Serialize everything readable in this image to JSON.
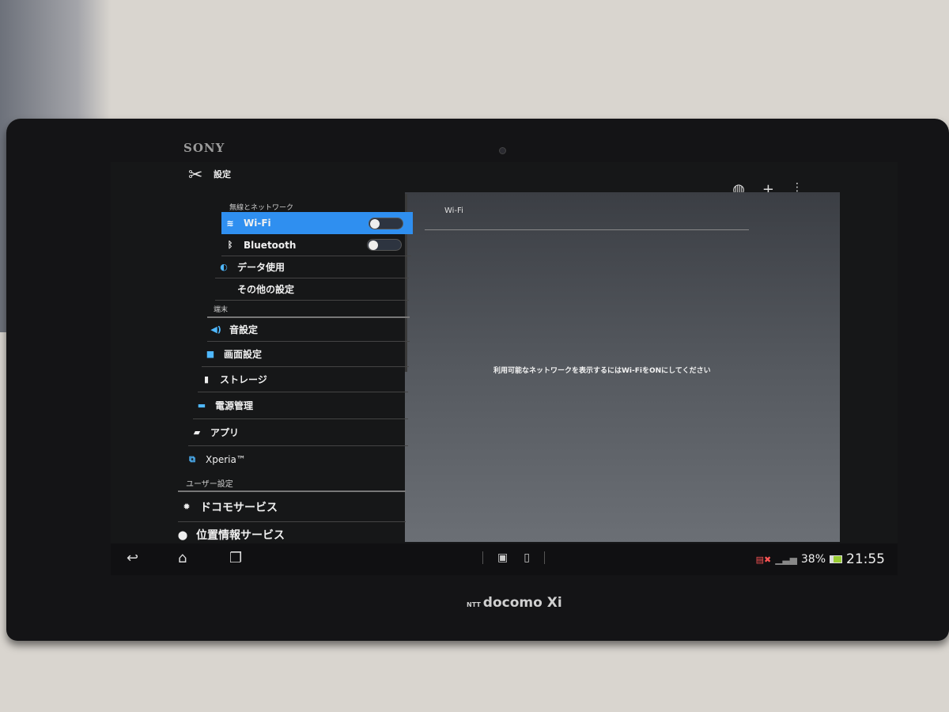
{
  "device": {
    "brand": "SONY",
    "carrier": "docomo Xi",
    "carrier_prefix": "NTT"
  },
  "app": {
    "title": "設定",
    "icon": "tools-icon"
  },
  "actionbar": {
    "icons": [
      "globe-icon",
      "plus-icon",
      "overflow-menu-icon"
    ]
  },
  "sections": {
    "wireless": "無線とネットワーク",
    "device": "端末",
    "user": "ユーザー設定"
  },
  "items": [
    {
      "label": "Wi-Fi",
      "icon": "wifi-icon",
      "toggle": false,
      "selected": true
    },
    {
      "label": "Bluetooth",
      "icon": "bluetooth-icon",
      "toggle": false
    },
    {
      "label": "データ使用",
      "icon": "data-usage-icon"
    },
    {
      "label": "その他の設定",
      "icon": ""
    },
    {
      "label": "音設定",
      "icon": "speaker-icon"
    },
    {
      "label": "画面設定",
      "icon": "display-icon"
    },
    {
      "label": "ストレージ",
      "icon": "storage-icon"
    },
    {
      "label": "電源管理",
      "icon": "battery-icon"
    },
    {
      "label": "アプリ",
      "icon": "apps-icon"
    },
    {
      "label": "Xperia™",
      "icon": "xperia-icon"
    },
    {
      "label": "ドコモサービス",
      "icon": "gear-icon"
    },
    {
      "label": "位置情報サービス",
      "icon": "location-icon"
    }
  ],
  "detail": {
    "title": "Wi-Fi",
    "message": "利用可能なネットワークを表示するにはWi-FiをONにしてください"
  },
  "status": {
    "battery": "38%",
    "time": "21:55",
    "accent": "#2f8ff0"
  }
}
